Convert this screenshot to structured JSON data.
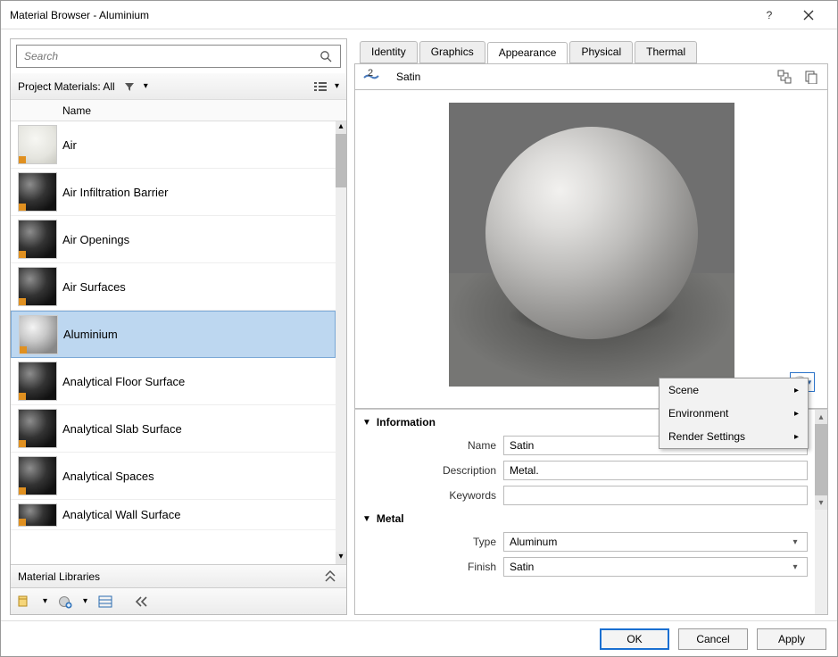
{
  "window": {
    "title": "Material Browser - Aluminium"
  },
  "search": {
    "placeholder": "Search"
  },
  "filter": {
    "label": "Project Materials: All"
  },
  "list_header": "Name",
  "materials": [
    {
      "name": "Air"
    },
    {
      "name": "Air Infiltration Barrier"
    },
    {
      "name": "Air Openings"
    },
    {
      "name": "Air Surfaces"
    },
    {
      "name": "Aluminium",
      "selected": true
    },
    {
      "name": "Analytical Floor Surface"
    },
    {
      "name": "Analytical Slab Surface"
    },
    {
      "name": "Analytical Spaces"
    },
    {
      "name": "Analytical Wall Surface"
    }
  ],
  "libraries_label": "Material Libraries",
  "tabs": [
    {
      "label": "Identity"
    },
    {
      "label": "Graphics"
    },
    {
      "label": "Appearance",
      "active": true
    },
    {
      "label": "Physical"
    },
    {
      "label": "Thermal"
    }
  ],
  "asset": {
    "count": "2",
    "name": "Satin"
  },
  "popup": {
    "scene": "Scene",
    "environment": "Environment",
    "render": "Render Settings"
  },
  "sections": {
    "info": {
      "title": "Information",
      "name_label": "Name",
      "name_value": "Satin",
      "desc_label": "Description",
      "desc_value": "Metal.",
      "keywords_label": "Keywords",
      "keywords_value": ""
    },
    "metal": {
      "title": "Metal",
      "type_label": "Type",
      "type_value": "Aluminum",
      "finish_label": "Finish",
      "finish_value": "Satin"
    }
  },
  "footer": {
    "ok": "OK",
    "cancel": "Cancel",
    "apply": "Apply"
  }
}
